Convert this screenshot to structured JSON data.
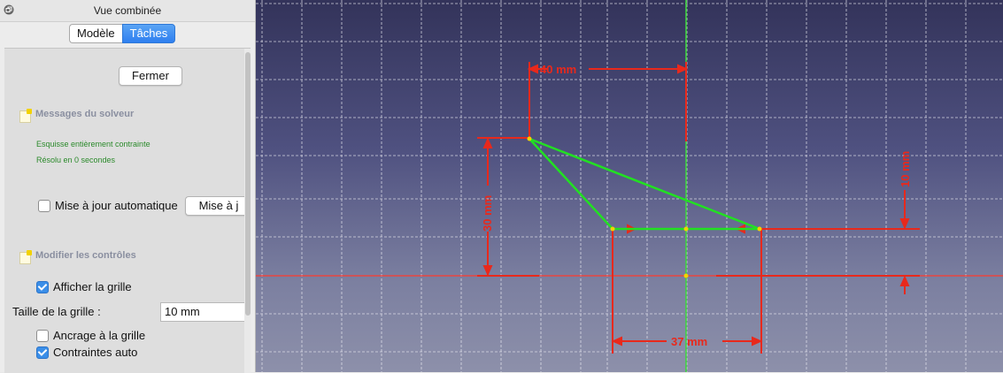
{
  "window": {
    "title": "Vue combinée"
  },
  "tabs": [
    {
      "label": "Modèle"
    },
    {
      "label": "Tâches"
    }
  ],
  "buttons": {
    "close_label": "Fermer",
    "update_label": "Mise à j"
  },
  "solver": {
    "heading": "Messages du solveur",
    "status": "Esquisse entièrement contrainte",
    "time": "Résolu en 0 secondes"
  },
  "auto_update": {
    "label": "Mise à jour automatique",
    "checked": false
  },
  "controls": {
    "heading": "Modifier les contrôles",
    "show_grid": {
      "label": "Afficher la grille",
      "checked": true
    },
    "grid_size": {
      "label": "Taille de la grille :",
      "value": "10 mm"
    },
    "snap_grid": {
      "label": "Ancrage à la grille",
      "checked": false
    },
    "auto_constraints": {
      "label": "Contraintes auto",
      "checked": true
    }
  },
  "dimensions": {
    "top_horizontal": "40 mm",
    "left_vertical": "30 mm",
    "right_vertical": "10 mm",
    "bottom_horizontal": "37 mm"
  },
  "colors": {
    "accent": "#2f7ff0",
    "constraint": "#e8291c",
    "geometry": "#22e022",
    "solver_text": "#2b8a2b"
  }
}
